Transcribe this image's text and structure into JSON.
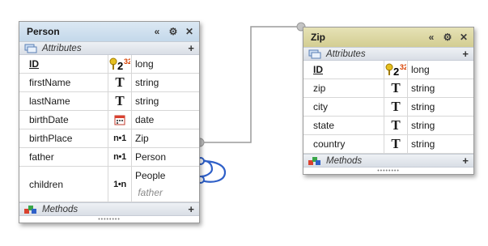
{
  "colors": {
    "person_header": "#cfe0ee",
    "zip_header": "#ddd8a6",
    "line": "#9b9b9b",
    "self_link": "#2f60c8"
  },
  "header_icons": [
    "collapse-icon",
    "gear-icon",
    "close-icon"
  ],
  "header_glyphs": {
    "collapse": "«",
    "gear": "⚙",
    "close": "✕"
  },
  "section_plus": "+",
  "person": {
    "title": "Person",
    "attributes_label": "Attributes",
    "methods_label": "Methods",
    "rows": [
      {
        "name": "ID",
        "icon": "key-number-icon",
        "type": "long"
      },
      {
        "name": "firstName",
        "icon": "text-type-icon",
        "glyph": "T",
        "type": "string"
      },
      {
        "name": "lastName",
        "icon": "text-type-icon",
        "glyph": "T",
        "type": "string"
      },
      {
        "name": "birthDate",
        "icon": "calendar-icon",
        "type": "date"
      },
      {
        "name": "birthPlace",
        "icon": "relation-icon",
        "glyph": "n•1",
        "type": "Zip"
      },
      {
        "name": "father",
        "icon": "relation-icon",
        "glyph": "n•1",
        "type": "Person"
      },
      {
        "name": "children",
        "icon": "relation-icon",
        "glyph": "1•n",
        "type": "People",
        "sub": "father"
      }
    ]
  },
  "zip": {
    "title": "Zip",
    "attributes_label": "Attributes",
    "methods_label": "Methods",
    "rows": [
      {
        "name": "ID",
        "icon": "key-number-icon",
        "type": "long"
      },
      {
        "name": "zip",
        "icon": "text-type-icon",
        "glyph": "T",
        "type": "string"
      },
      {
        "name": "city",
        "icon": "text-type-icon",
        "glyph": "T",
        "type": "string"
      },
      {
        "name": "state",
        "icon": "text-type-icon",
        "glyph": "T",
        "type": "string"
      },
      {
        "name": "country",
        "icon": "text-type-icon",
        "glyph": "T",
        "type": "string"
      }
    ]
  }
}
